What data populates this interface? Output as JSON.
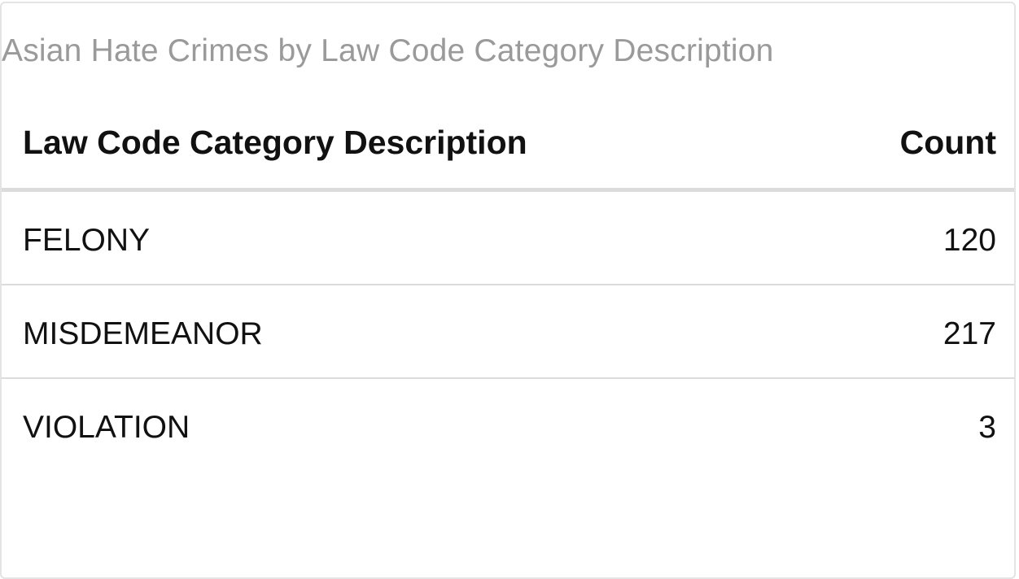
{
  "chart_data": {
    "type": "table",
    "title": "Asian Hate Crimes by Law Code Category Description",
    "columns": [
      "Law Code Category Description",
      "Count"
    ],
    "rows": [
      {
        "category": "FELONY",
        "count": "120"
      },
      {
        "category": "MISDEMEANOR",
        "count": "217"
      },
      {
        "category": "VIOLATION",
        "count": "3"
      }
    ]
  }
}
